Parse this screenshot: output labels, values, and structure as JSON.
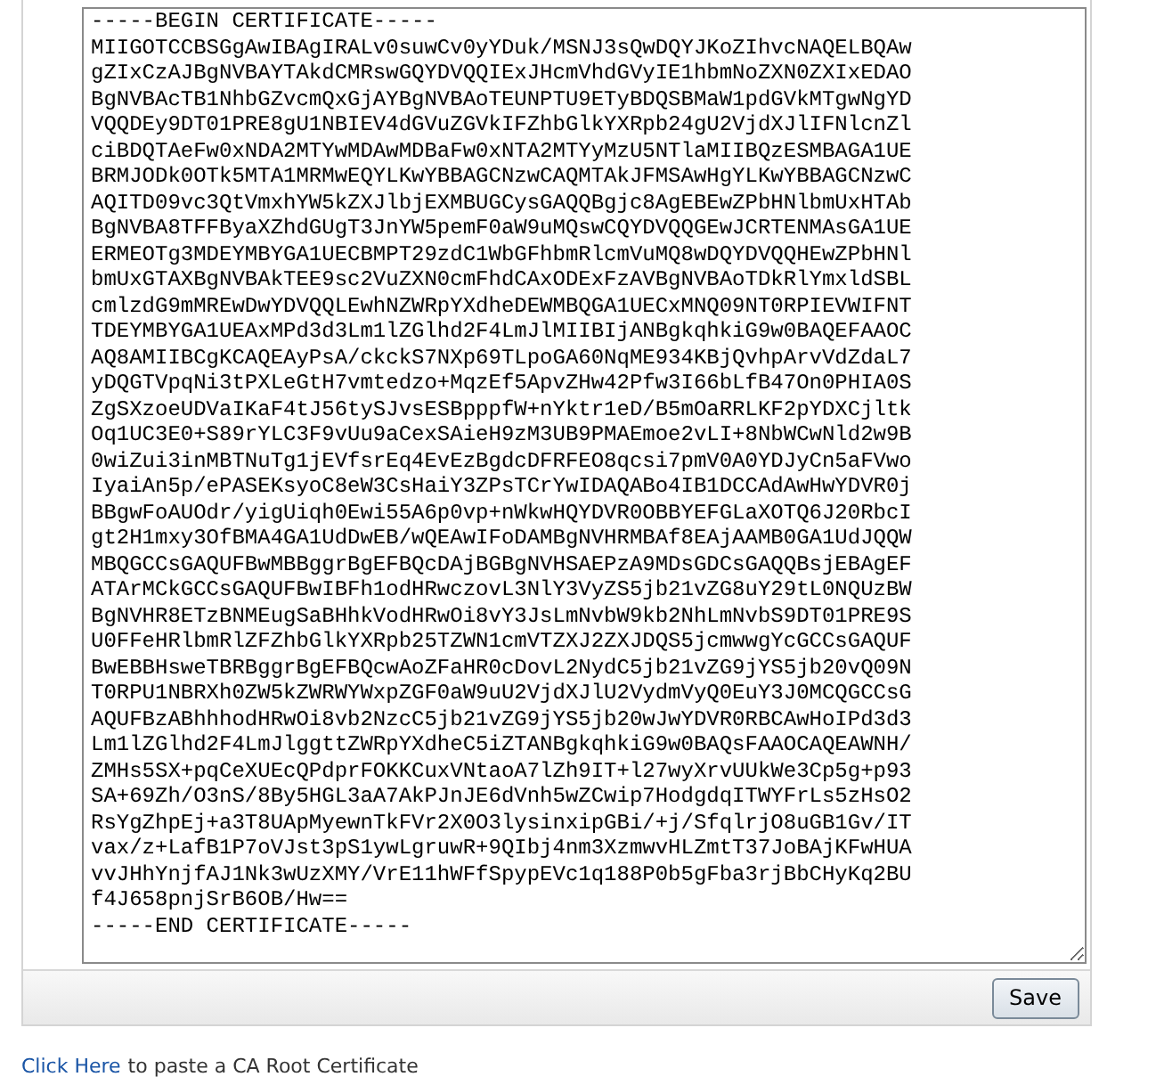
{
  "certificate": {
    "value": "-----BEGIN CERTIFICATE-----\nMIIGOTCCBSGgAwIBAgIRALv0suwCv0yYDuk/MSNJ3sQwDQYJKoZIhvcNAQELBQAw\ngZIxCzAJBgNVBAYTAkdCMRswGQYDVQQIExJHcmVhdGVyIE1hbmNoZXN0ZXIxEDAO\nBgNVBAcTB1NhbGZvcmQxGjAYBgNVBAoTEUNPTU9ETyBDQSBMaW1pdGVkMTgwNgYD\nVQQDEy9DT01PRE8gU1NBIEV4dGVuZGVkIFZhbGlkYXRpb24gU2VjdXJlIFNlcnZl\nciBDQTAeFw0xNDA2MTYwMDAwMDBaFw0xNTA2MTYyMzU5NTlaMIIBQzESMBAGA1UE\nBRMJODk0OTk5MTA1MRMwEQYLKwYBBAGCNzwCAQMTAkJFMSAwHgYLKwYBBAGCNzwC\nAQITD09vc3QtVmxhYW5kZXJlbjEXMBUGCysGAQQBgjc8AgEBEwZPbHNlbmUxHTAb\nBgNVBA8TFFByaXZhdGUgT3JnYW5pemF0aW9uMQswCQYDVQQGEwJCRTENMAsGA1UE\nERMEOTg3MDEYMBYGA1UECBMPT29zdC1WbGFhbmRlcmVuMQ8wDQYDVQQHEwZPbHNl\nbmUxGTAXBgNVBAkTEE9sc2VuZXN0cmFhdCAxODExFzAVBgNVBAoTDkRlYmxldSBL\ncmlzdG9mMREwDwYDVQQLEwhNZWRpYXdheDEWMBQGA1UECxMNQ09NT0RPIEVWIFNT\nTDEYMBYGA1UEAxMPd3d3Lm1lZGlhd2F4LmJlMIIBIjANBgkqhkiG9w0BAQEFAAOC\nAQ8AMIIBCgKCAQEAyPsA/ckckS7NXp69TLpoGA60NqME934KBjQvhpArvVdZdaL7\nyDQGTVpqNi3tPXLeGtH7vmtedzo+MqzEf5ApvZHw42Pfw3I66bLfB47On0PHIA0S\nZgSXzoeUDVaIKaF4tJ56tySJvsESBpppfW+nYktr1eD/B5mOaRRLKF2pYDXCjltk\nOq1UC3E0+S89rYLC3F9vUu9aCexSAieH9zM3UB9PMAEmoe2vLI+8NbWCwNld2w9B\n0wiZui3inMBTNuTg1jEVfsrEq4EvEzBgdcDFRFEO8qcsi7pmV0A0YDJyCn5aFVwo\nIyaiAn5p/ePASEKsyoC8eW3CsHaiY3ZPsTCrYwIDAQABo4IB1DCCAdAwHwYDVR0j\nBBgwFoAUOdr/yigUiqh0Ewi55A6p0vp+nWkwHQYDVR0OBBYEFGLaXOTQ6J20RbcI\ngt2H1mxy3OfBMA4GA1UdDwEB/wQEAwIFoDAMBgNVHRMBAf8EAjAAMB0GA1UdJQQW\nMBQGCCsGAQUFBwMBBggrBgEFBQcDAjBGBgNVHSAEPzA9MDsGDCsGAQQBsjEBAgEF\nATArMCkGCCsGAQUFBwIBFh1odHRwczovL3NlY3VyZS5jb21vZG8uY29tL0NQUzBW\nBgNVHR8ETzBNMEugSaBHhkVodHRwOi8vY3JsLmNvbW9kb2NhLmNvbS9DT01PRE9S\nU0FFeHRlbmRlZFZhbGlkYXRpb25TZWN1cmVTZXJ2ZXJDQS5jcmwwgYcGCCsGAQUF\nBwEBBHsweTBRBggrBgEFBQcwAoZFaHR0cDovL2NydC5jb21vZG9jYS5jb20vQ09N\nT0RPU1NBRXh0ZW5kZWRWYWxpZGF0aW9uU2VjdXJlU2VydmVyQ0EuY3J0MCQGCCsG\nAQUFBzABhhhodHRwOi8vb2NzcC5jb21vZG9jYS5jb20wJwYDVR0RBCAwHoIPd3d3\nLm1lZGlhd2F4LmJlggttZWRpYXdheC5iZTANBgkqhkiG9w0BAQsFAAOCAQEAWNH/\nZMHs5SX+pqCeXUEcQPdprFOKKCuxVNtaoA7lZh9IT+l27wyXrvUUkWe3Cp5g+p93\nSA+69Zh/O3nS/8By5HGL3aA7AkPJnJE6dVnh5wZCwip7HodgdqITWYFrLs5zHsO2\nRsYgZhpEj+a3T8UApMyewnTkFVr2X0O3lysinxipGBi/+j/SfqlrjO8uGB1Gv/IT\nvax/z+LafB1P7oVJst3pS1ywLgruwR+9QIbj4nm3XzmwvHLZmtT37JoBAjKFwHUA\nvvJHhYnjfAJ1Nk3wUzXMY/VrE11hWFfSpypEVc1q188P0b5gFba3rjBbCHyKq2BU\nf4J658pnjSrB6OB/Hw==\n-----END CERTIFICATE-----"
  },
  "save_button": "Save",
  "footer": {
    "link": "Click Here",
    "text": "to paste a CA Root Certificate"
  }
}
